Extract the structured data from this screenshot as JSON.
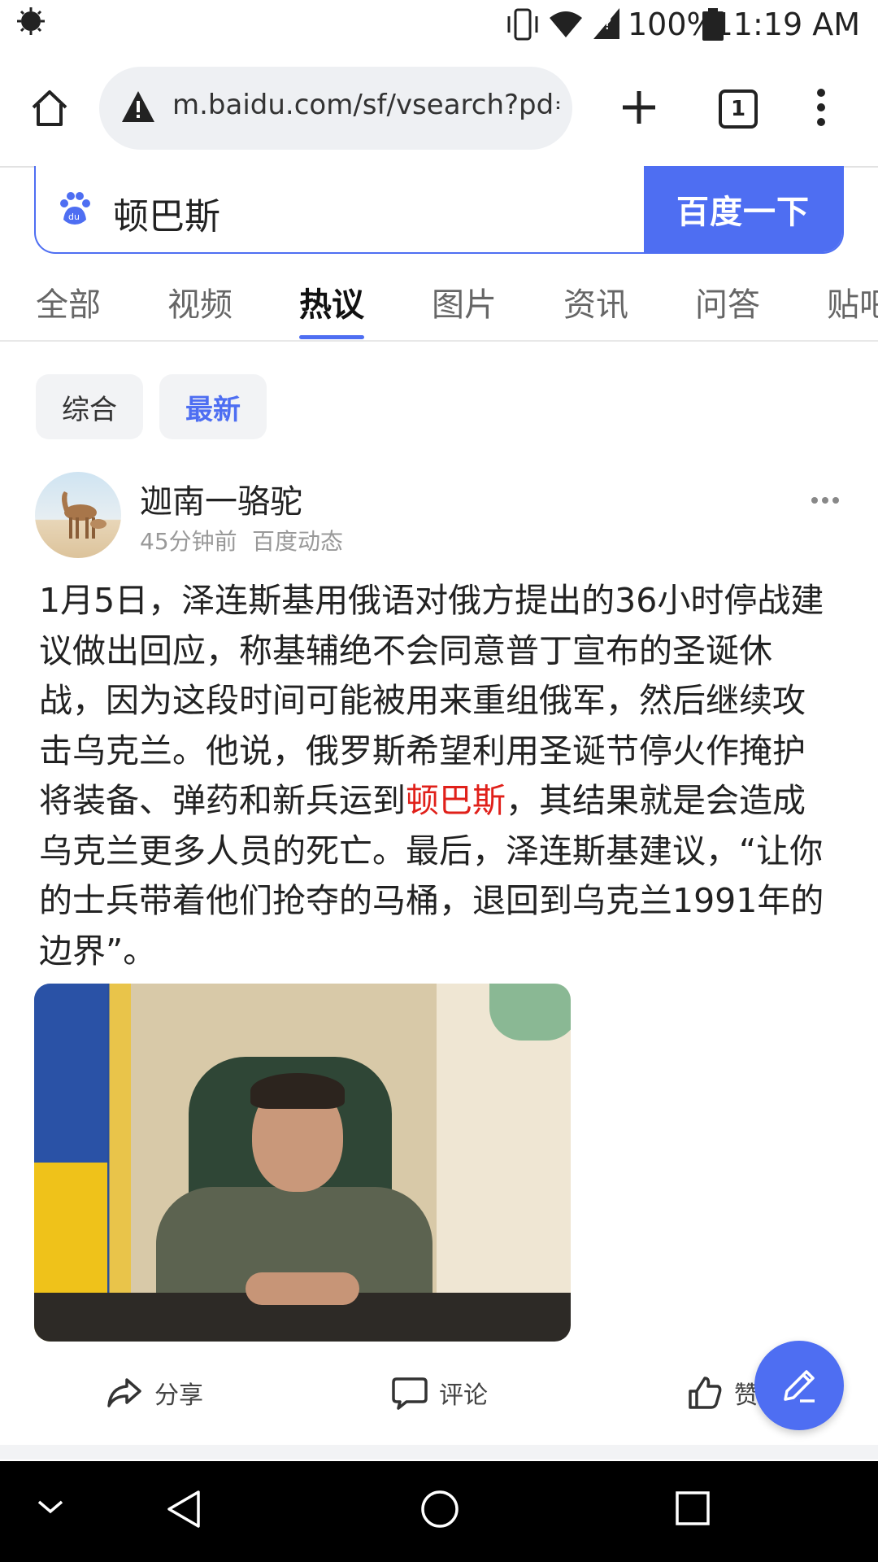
{
  "status_bar": {
    "battery_percent": "100%",
    "time": "11:19 AM"
  },
  "browser": {
    "url": "m.baidu.com/sf/vsearch?pd=r",
    "tab_count": "1"
  },
  "search": {
    "query": "顿巴斯",
    "button_label": "百度一下"
  },
  "tabs": [
    "全部",
    "视频",
    "热议",
    "图片",
    "资讯",
    "问答",
    "贴吧"
  ],
  "active_tab": "热议",
  "filter_chips": {
    "all": "综合",
    "latest": "最新"
  },
  "post": {
    "author": "迦南一骆驼",
    "time": "45分钟前",
    "source": "百度动态",
    "text_before": "1月5日，泽连斯基用俄语对俄方提出的36小时停战建议做出回应，称基辅绝不会同意普丁宣布的圣诞休战，因为这段时间可能被用来重组俄军，然后继续攻击乌克兰。他说，俄罗斯希望利用圣诞节停火作掩护将装备、弹药和新兵运到",
    "highlight": "顿巴斯",
    "text_after": "，其结果就是会造成乌克兰更多人员的死亡。最后，泽连斯基建议，“让你的士兵带着他们抢夺的马桶，退回到乌克兰1991年的边界”。"
  },
  "actions": {
    "share": "分享",
    "comment": "评论",
    "like": "赞"
  },
  "colors": {
    "accent": "#4e6ef2",
    "highlight": "#e0201a"
  }
}
